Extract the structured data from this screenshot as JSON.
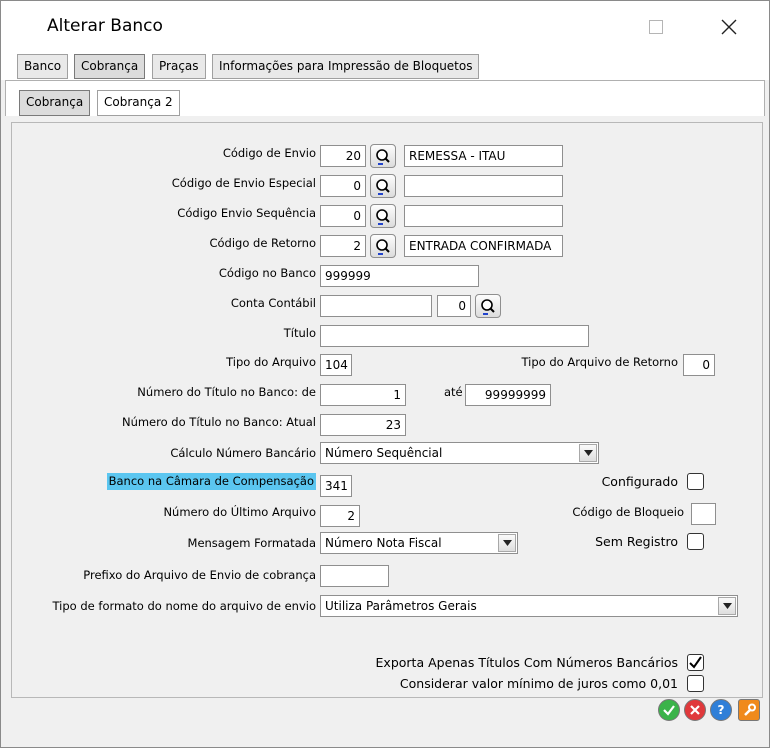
{
  "window": {
    "title": "Alterar Banco"
  },
  "tabs_main": [
    "Banco",
    "Cobrança",
    "Praças",
    "Informações para Impressão de Bloquetos"
  ],
  "tabs_sub": [
    "Cobrança",
    "Cobrança 2"
  ],
  "fields": {
    "codigo_envio": {
      "label": "Código de Envio",
      "value": "20",
      "desc": "REMESSA - ITAU"
    },
    "codigo_envio_especial": {
      "label": "Código de Envio Especial",
      "value": "0",
      "desc": ""
    },
    "codigo_envio_sequencia": {
      "label": "Código  Envio Sequência",
      "value": "0",
      "desc": ""
    },
    "codigo_retorno": {
      "label": "Código de Retorno",
      "value": "2",
      "desc": "ENTRADA CONFIRMADA"
    },
    "codigo_banco": {
      "label": "Código no Banco",
      "value": "999999"
    },
    "conta_contabil": {
      "label": "Conta Contábil",
      "value": "",
      "value2": "0"
    },
    "titulo": {
      "label": "Título",
      "value": ""
    },
    "tipo_arquivo": {
      "label": "Tipo do Arquivo",
      "value": "104"
    },
    "tipo_arquivo_retorno": {
      "label": "Tipo do Arquivo de Retorno",
      "value": "0"
    },
    "numero_titulo_de": {
      "label": "Número do Título no Banco: de",
      "value": "1"
    },
    "ate": {
      "label": "até",
      "value": "99999999"
    },
    "numero_titulo_atual": {
      "label": "Número do Título no Banco: Atual",
      "value": "23"
    },
    "calculo_numero": {
      "label": "Cálculo Número Bancário",
      "value": "Número Sequêncial"
    },
    "banco_camara": {
      "label": "Banco na Câmara de Compensação",
      "value": "341"
    },
    "configurado": {
      "label": "Configurado"
    },
    "numero_ultimo_arquivo": {
      "label": "Número do Último Arquivo",
      "value": "2"
    },
    "codigo_bloqueio": {
      "label": "Código de Bloqueio",
      "value": ""
    },
    "mensagem_formatada": {
      "label": "Mensagem Formatada",
      "value": "Número Nota Fiscal"
    },
    "sem_registro": {
      "label": "Sem Registro"
    },
    "prefixo_arquivo": {
      "label": "Prefixo do Arquivo de Envio de cobrança",
      "value": ""
    },
    "tipo_formato": {
      "label": "Tipo de formato do nome do arquivo de envio",
      "value": "Utiliza Parâmetros Gerais"
    },
    "exporta_apenas": {
      "label": "Exporta Apenas Títulos Com Números Bancários"
    },
    "considerar_valor": {
      "label": "Considerar valor mínimo de juros como 0,01"
    }
  },
  "colors": {
    "ok": "#3bb34a",
    "cancel": "#e0393c",
    "help": "#2f7fd8",
    "tool": "#f08a1c",
    "highlight": "#5bc6f0"
  }
}
